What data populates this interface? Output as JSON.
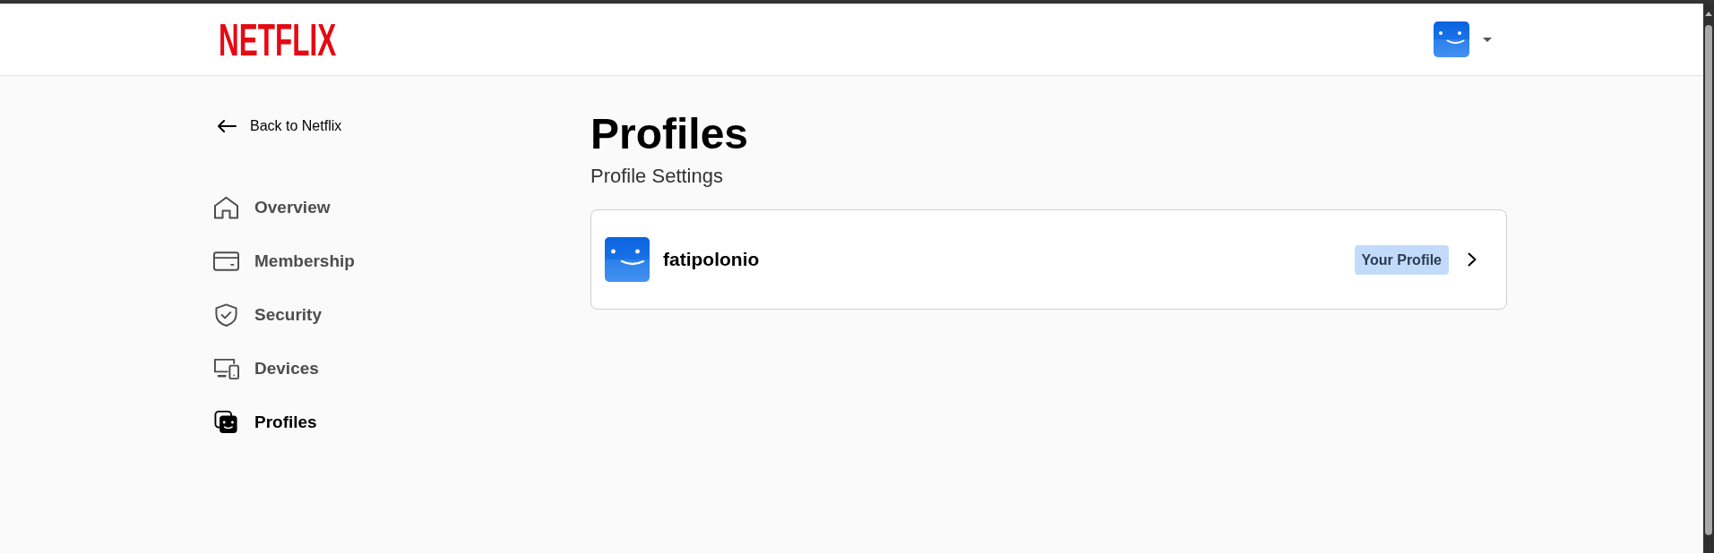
{
  "header": {
    "logo": "NETFLIX"
  },
  "sidebar": {
    "back_link": "Back to Netflix",
    "items": [
      {
        "kind": "home",
        "label": "Overview",
        "selected": false
      },
      {
        "kind": "card",
        "label": "Membership",
        "selected": false
      },
      {
        "kind": "shield",
        "label": "Security",
        "selected": false
      },
      {
        "kind": "devices",
        "label": "Devices",
        "selected": false
      },
      {
        "kind": "profiles",
        "label": "Profiles",
        "selected": true
      }
    ]
  },
  "main": {
    "title": "Profiles",
    "subtitle": "Profile Settings",
    "profiles": [
      {
        "name": "fatipolonio",
        "badge": "Your Profile"
      }
    ]
  }
}
